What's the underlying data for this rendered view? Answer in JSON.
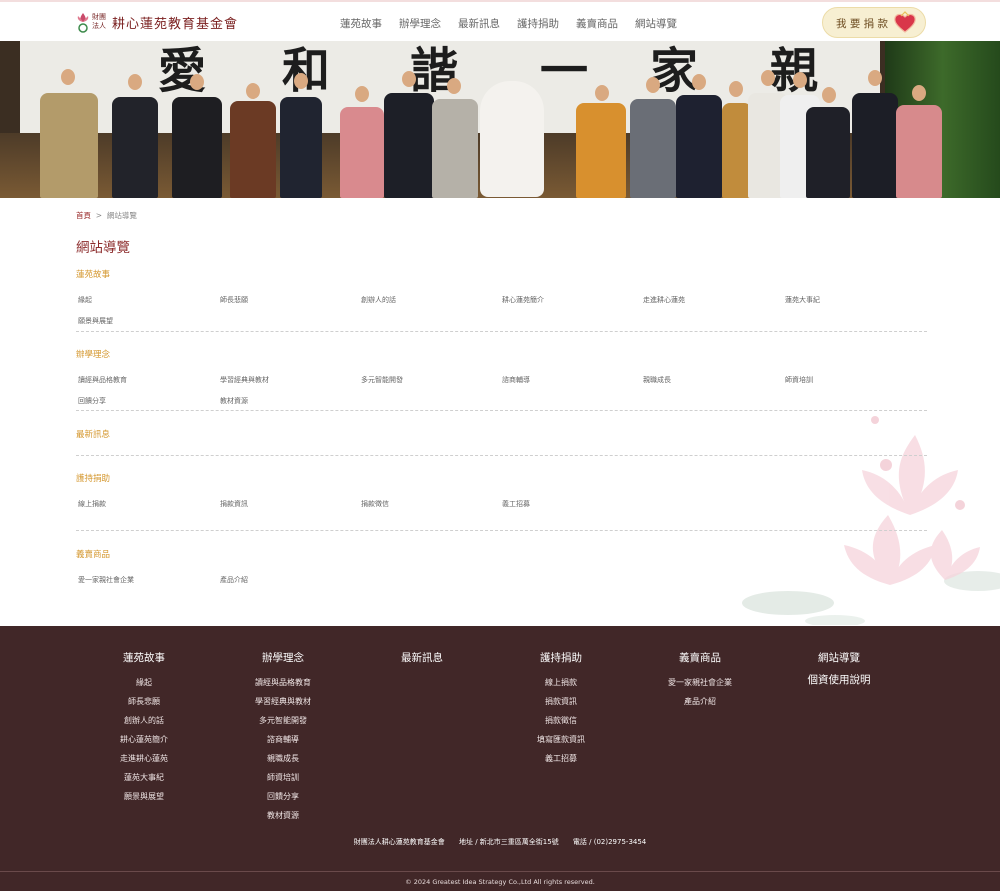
{
  "header": {
    "logo": {
      "small_text": "財團法人",
      "name": "耕心蓮苑教育基金會"
    },
    "nav": [
      "蓮苑故事",
      "辦學理念",
      "最新訊息",
      "護持捐助",
      "義賣商品",
      "網站導覽"
    ],
    "donate_label": "我 要 捐 款",
    "accent": "#8c2c2c"
  },
  "banner": {
    "calligraphy": [
      "愛",
      "和",
      "諧",
      "一",
      "家",
      "親"
    ]
  },
  "breadcrumb": {
    "home": "首頁",
    "separator": ">",
    "current": "網站導覽"
  },
  "page_title": "網站導覽",
  "sections": [
    {
      "title": "蓮苑故事",
      "items": [
        "緣起",
        "師長悲願",
        "創辦人的話",
        "耕心蓮苑簡介",
        "走進耕心蓮苑",
        "蓮苑大事紀",
        "願景與展望"
      ]
    },
    {
      "title": "辦學理念",
      "items": [
        "讀經與品格教育",
        "學習經典與教材",
        "多元智能開發",
        "諮商輔導",
        "親職成長",
        "師資培訓",
        "回饋分享",
        "教材資源"
      ]
    },
    {
      "title": "最新訊息",
      "items": []
    },
    {
      "title": "護持捐助",
      "items": [
        "線上捐款",
        "捐款資訊",
        "捐款徵信",
        "義工招募"
      ]
    },
    {
      "title": "義賣商品",
      "items": [
        "愛一家親社會企業",
        "產品介紹"
      ]
    }
  ],
  "footer": {
    "columns": [
      {
        "title": "蓮苑故事",
        "items": [
          "緣起",
          "師長悲願",
          "創辦人的話",
          "耕心蓮苑簡介",
          "走進耕心蓮苑",
          "蓮苑大事紀",
          "願景與展望"
        ]
      },
      {
        "title": "辦學理念",
        "items": [
          "讀經與品格教育",
          "學習經典與教材",
          "多元智能開發",
          "諮商輔導",
          "親職成長",
          "師資培訓",
          "回饋分享",
          "教材資源"
        ]
      },
      {
        "title": "最新訊息",
        "items": []
      },
      {
        "title": "護持捐助",
        "items": [
          "線上捐款",
          "捐款資訊",
          "捐款徵信",
          "填寫匯款資訊",
          "義工招募"
        ]
      },
      {
        "title": "義賣商品",
        "items": [
          "愛一家親社會企業",
          "產品介紹"
        ]
      },
      {
        "title": "網站導覽",
        "items": [
          "個資使用說明"
        ]
      }
    ],
    "org_name": "財團法人耕心蓮苑教育基金會",
    "address": "地址 / 新北市三重區萬全街15號",
    "phone": "電話 / (02)2975-3454",
    "copyright": "© 2024 Greatest Idea Strategy Co.,Ltd All rights reserved.",
    "background": "#412728"
  }
}
